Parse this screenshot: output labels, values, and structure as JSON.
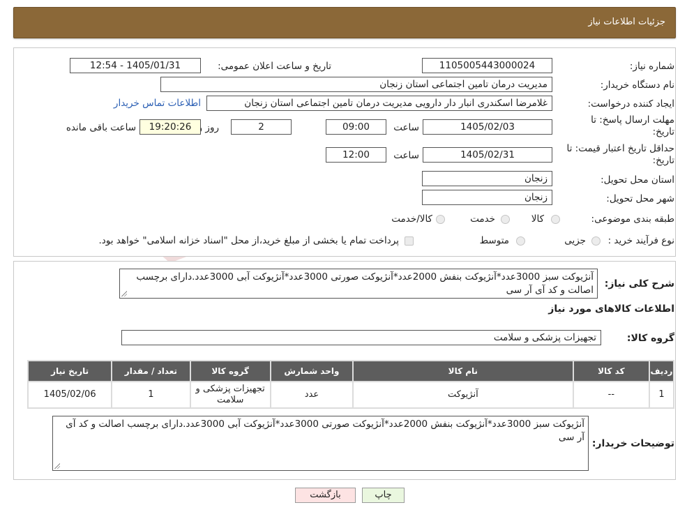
{
  "header": {
    "title": "جزئیات اطلاعات نیاز"
  },
  "watermark": {
    "text": "AriaTender.neT"
  },
  "form": {
    "need_number_label": "شماره نیاز:",
    "need_number": "1105005443000024",
    "announce_label": "تاریخ و ساعت اعلان عمومی:",
    "announce_value": "1405/01/31 - 12:54",
    "buyer_org_label": "نام دستگاه خریدار:",
    "buyer_org": "مدیریت درمان تامین اجتماعی استان زنجان",
    "requester_label": "ایجاد کننده درخواست:",
    "requester": "غلامرضا  اسکندری انبار دار دارویی مدیریت درمان تامین اجتماعی استان زنجان",
    "contact_link": "اطلاعات تماس خریدار",
    "deadline_label": "مهلت ارسال پاسخ: تا تاریخ:",
    "deadline_date": "1405/02/03",
    "time_label": "ساعت",
    "deadline_time": "09:00",
    "days_value": "2",
    "days_label": "روز و",
    "remaining_time": "19:20:26",
    "remaining_label": "ساعت باقی مانده",
    "validity_label": "حداقل تاریخ اعتبار قیمت: تا تاریخ:",
    "validity_date": "1405/02/31",
    "validity_time": "12:00",
    "province_label": "استان محل تحویل:",
    "province": "زنجان",
    "city_label": "شهر محل تحویل:",
    "city": "زنجان",
    "category_label": "طبقه بندی موضوعی:",
    "category_options": [
      "کالا",
      "خدمت",
      "کالا/خدمت"
    ],
    "process_label": "نوع فرآیند خرید :",
    "process_options": [
      "جزیی",
      "متوسط"
    ],
    "process_note": "پرداخت تمام یا بخشی از مبلغ خرید،از محل \"اسناد خزانه اسلامی\" خواهد بود."
  },
  "summary": {
    "label": "شرح کلی نیاز:",
    "text": "آنژیوکت سبز 3000عدد*آنژیوکت بنفش 2000عدد*آنژیوکت صورتی 3000عدد*آنژیوکت آبی 3000عدد.دارای برچسب اصالت و کد آی آر سی"
  },
  "goods": {
    "section_title": "اطلاعات کالاهای مورد نیاز",
    "group_label": "گروه کالا:",
    "group_value": "تجهیزات پزشکی و سلامت",
    "table": {
      "headers": [
        "ردیف",
        "کد کالا",
        "نام کالا",
        "واحد شمارش",
        "گروه کالا",
        "تعداد / مقدار",
        "تاریخ نیاز"
      ],
      "rows": [
        [
          "1",
          "--",
          "آنژیوکت",
          "عدد",
          "تجهیزات پزشکی و سلامت",
          "1",
          "1405/02/06"
        ]
      ]
    }
  },
  "buyer_notes": {
    "label": "توضیحات خریدار:",
    "text": "آنژیوکت سبز 3000عدد*آنژیوکت بنفش 2000عدد*آنژیوکت صورتی 3000عدد*آنژیوکت آبی 3000عدد.دارای برچسب اصالت و کد آی آر سی"
  },
  "buttons": {
    "print": "چاپ",
    "back": "بازگشت"
  }
}
